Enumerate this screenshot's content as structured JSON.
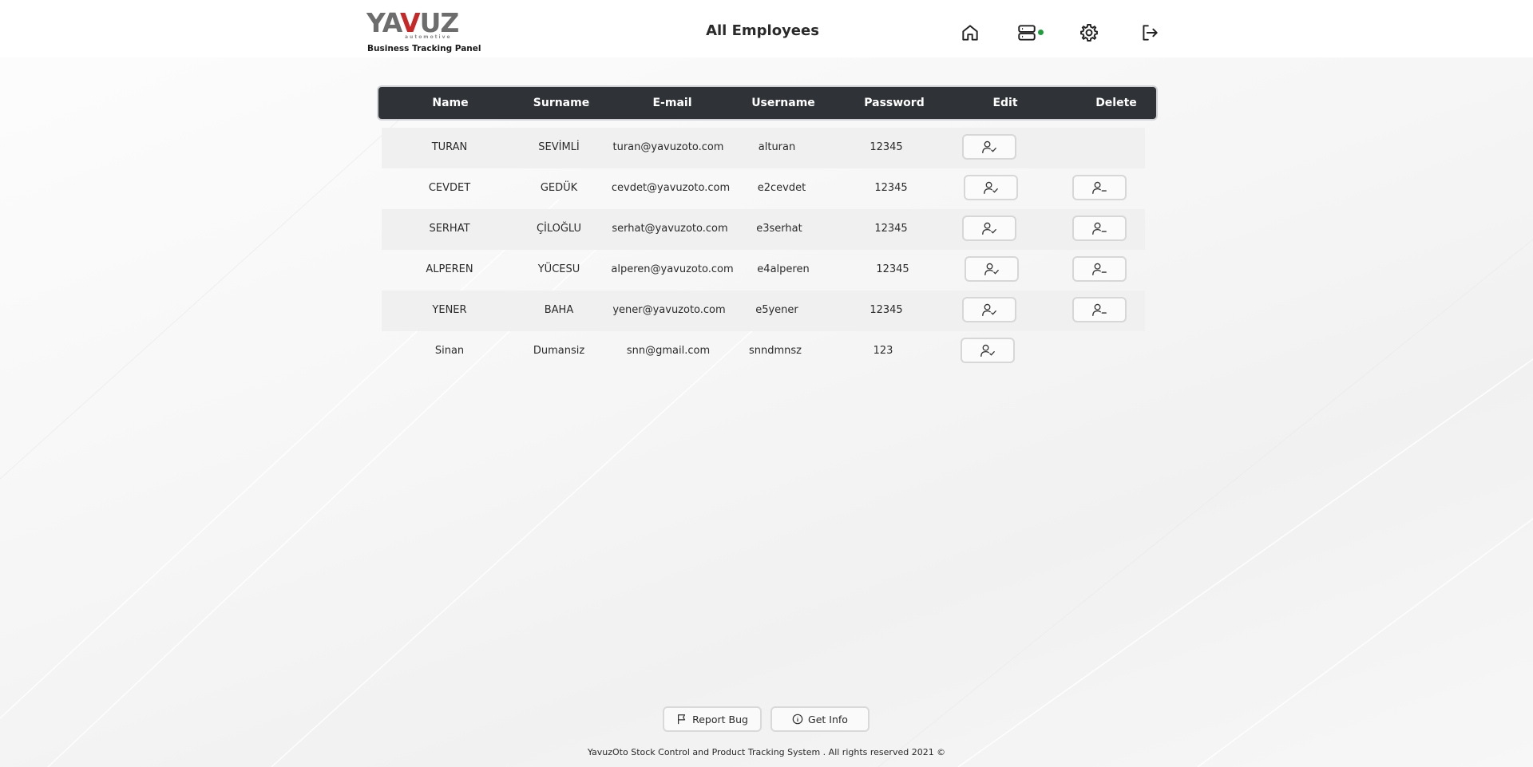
{
  "header": {
    "logo_brand": "YAVUZ",
    "logo_sub": "automotive",
    "logo_tagline": "Business Tracking Panel",
    "page_title": "All Employees",
    "nav_icons": [
      "home-icon",
      "server-icon",
      "settings-icon",
      "logout-icon"
    ],
    "status_color": "#1e9e3c"
  },
  "table": {
    "columns": [
      "Name",
      "Surname",
      "E-mail",
      "Username",
      "Password",
      "Edit",
      "Delete"
    ],
    "rows": [
      {
        "name": "TURAN",
        "surname": "SEVİMLİ",
        "email": "turan@yavuzoto.com",
        "username": "alturan",
        "password": "12345",
        "has_delete": false
      },
      {
        "name": "CEVDET",
        "surname": "GEDÜK",
        "email": "cevdet@yavuzoto.com",
        "username": "e2cevdet",
        "password": "12345",
        "has_delete": true
      },
      {
        "name": "SERHAT",
        "surname": "ÇİLOĞLU",
        "email": "serhat@yavuzoto.com",
        "username": "e3serhat",
        "password": "12345",
        "has_delete": true
      },
      {
        "name": "ALPEREN",
        "surname": "YÜCESU",
        "email": "alperen@yavuzoto.com",
        "username": "e4alperen",
        "password": "12345",
        "has_delete": true
      },
      {
        "name": "YENER",
        "surname": "BAHA",
        "email": "yener@yavuzoto.com",
        "username": "e5yener",
        "password": "12345",
        "has_delete": true
      },
      {
        "name": "Sinan",
        "surname": "Dumansiz",
        "email": "snn@gmail.com",
        "username": "snndmnsz",
        "password": "123",
        "has_delete": false
      }
    ]
  },
  "footer": {
    "report_bug": "Report Bug",
    "get_info": "Get Info",
    "copyright": "YavuzOto Stock Control and Product Tracking System . All rights reserved 2021 ©"
  },
  "colors": {
    "header_bar": "#2f3237",
    "accent_red": "#c62828"
  }
}
